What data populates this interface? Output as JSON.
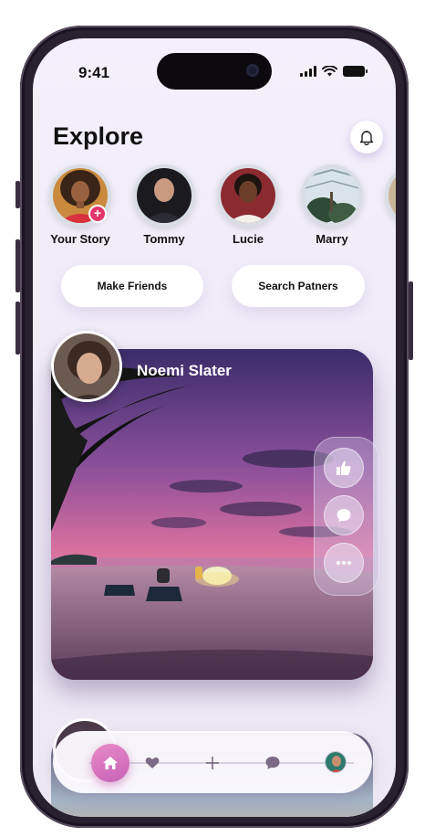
{
  "status_bar": {
    "time": "9:41"
  },
  "header": {
    "title": "Explore"
  },
  "stories": [
    {
      "name": "Your Story"
    },
    {
      "name": "Tommy"
    },
    {
      "name": "Lucie"
    },
    {
      "name": "Marry"
    }
  ],
  "actions": {
    "make_friends": "Make Friends",
    "search_partners": "Search Patners"
  },
  "post": {
    "author": "Noemi Slater"
  },
  "icons": {
    "bell": "bell-icon",
    "like": "thumbs-up-icon",
    "comment": "chat-bubble-icon",
    "more": "more-dots-icon",
    "home": "home-icon",
    "favorites": "heart-icon",
    "add": "plus-icon",
    "messages": "chat-icon",
    "profile": "avatar"
  },
  "colors": {
    "accent": "#d46fbf",
    "badge": "#e3346a",
    "background": "#f1edf8"
  }
}
